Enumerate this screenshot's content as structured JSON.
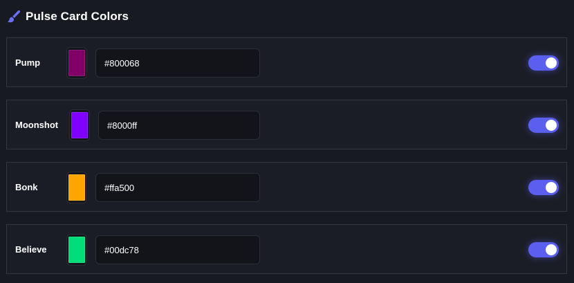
{
  "section": {
    "title": "Pulse Card Colors",
    "icon": "paintbrush-icon",
    "icon_color": "#6b6ff5"
  },
  "rows": [
    {
      "label": "Pump",
      "hex": "#800068",
      "color": "#800068",
      "enabled": true
    },
    {
      "label": "Moonshot",
      "hex": "#8000ff",
      "color": "#8000ff",
      "enabled": true
    },
    {
      "label": "Bonk",
      "hex": "#ffa500",
      "color": "#ffa500",
      "enabled": true
    },
    {
      "label": "Believe",
      "hex": "#00dc78",
      "color": "#00dc78",
      "enabled": true
    }
  ],
  "theme": {
    "background": "#181a22",
    "row_background": "#1b1d26",
    "toggle_on": "#5b5fef"
  }
}
